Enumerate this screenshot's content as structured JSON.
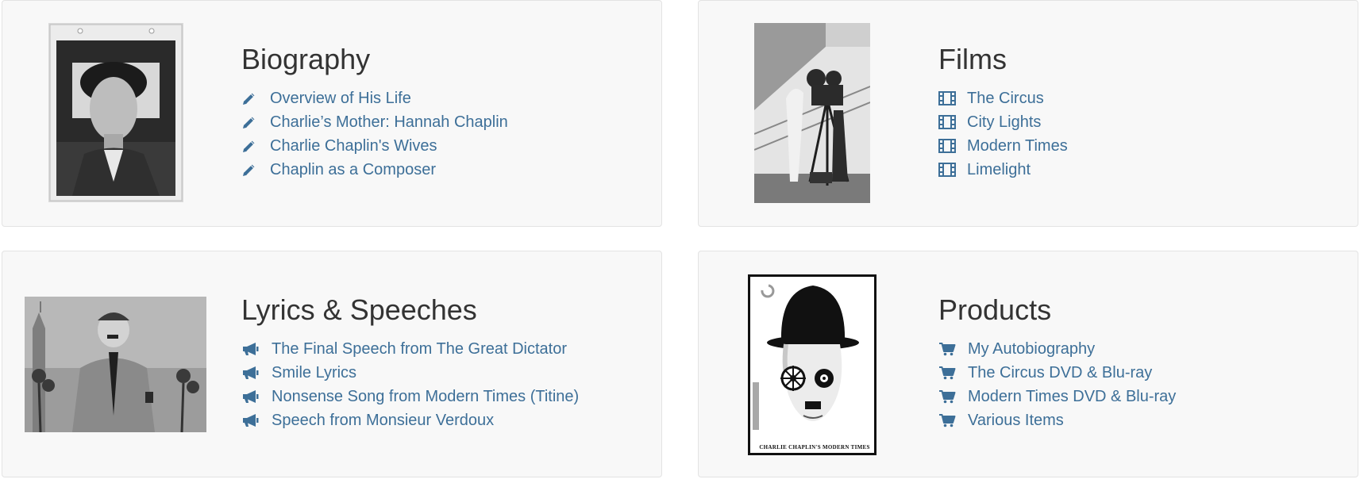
{
  "colors": {
    "link": "#3d6f98",
    "panel_bg": "#f8f8f8",
    "panel_border": "#e3e3e3",
    "heading": "#333333"
  },
  "sections": [
    {
      "title": "Biography",
      "icon": "pencil-icon",
      "links": [
        "Overview of His Life",
        "Charlie’s Mother: Hannah Chaplin",
        "Charlie Chaplin's Wives",
        "Chaplin as a Composer"
      ]
    },
    {
      "title": "Films",
      "icon": "film-icon",
      "links": [
        "The Circus",
        "City Lights",
        "Modern Times",
        "Limelight"
      ]
    },
    {
      "title": "Lyrics & Speeches",
      "icon": "bullhorn-icon",
      "links": [
        "The Final Speech from The Great Dictator",
        "Smile Lyrics",
        "Nonsense Song from Modern Times (Titine)",
        "Speech from Monsieur Verdoux"
      ]
    },
    {
      "title": "Products",
      "icon": "shopping-cart-icon",
      "links": [
        "My Autobiography",
        "The Circus DVD & Blu-ray",
        "Modern Times DVD & Blu-ray",
        "Various Items"
      ]
    }
  ],
  "dvd_cover_caption": "CHARLIE CHAPLIN'S MODERN TIMES"
}
